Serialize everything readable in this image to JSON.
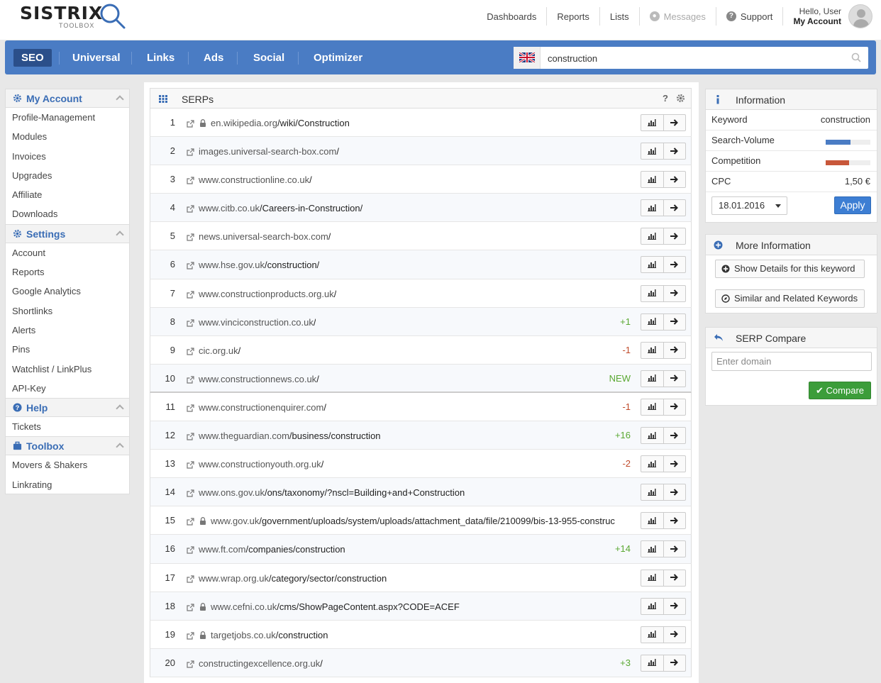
{
  "brand": {
    "name": "SISTRIX",
    "sub": "TOOLBOX"
  },
  "topnav": {
    "dashboards": "Dashboards",
    "reports": "Reports",
    "lists": "Lists",
    "messages": "Messages",
    "support": "Support",
    "hello": "Hello, User",
    "my_account": "My Account"
  },
  "modules": [
    "SEO",
    "Universal",
    "Links",
    "Ads",
    "Social",
    "Optimizer"
  ],
  "search": {
    "value": "construction",
    "flag": "uk-flag-icon"
  },
  "sidebar": {
    "my_account": {
      "title": "My Account",
      "items": [
        "Profile-Management",
        "Modules",
        "Invoices",
        "Upgrades",
        "Affiliate",
        "Downloads"
      ]
    },
    "settings": {
      "title": "Settings",
      "items": [
        "Account",
        "Reports",
        "Google Analytics",
        "Shortlinks",
        "Alerts",
        "Pins",
        "Watchlist / LinkPlus",
        "API-Key"
      ]
    },
    "help": {
      "title": "Help",
      "items": [
        "Tickets"
      ]
    },
    "toolbox": {
      "title": "Toolbox",
      "items": [
        "Movers & Shakers",
        "Linkrating"
      ]
    }
  },
  "serps": {
    "title": "SERPs",
    "help": "?",
    "rows": [
      {
        "n": "1",
        "dom": "en.wikipedia.org",
        "path": "/wiki/Construction",
        "lock": true,
        "chg": "",
        "cls": ""
      },
      {
        "n": "2",
        "dom": "images.universal-search-box.com",
        "path": "/",
        "lock": false,
        "chg": "",
        "cls": ""
      },
      {
        "n": "3",
        "dom": "www.constructionline.co.uk",
        "path": "/",
        "lock": false,
        "chg": "",
        "cls": ""
      },
      {
        "n": "4",
        "dom": "www.citb.co.uk",
        "path": "/Careers-in-Construction/",
        "lock": false,
        "chg": "",
        "cls": ""
      },
      {
        "n": "5",
        "dom": "news.universal-search-box.com",
        "path": "/",
        "lock": false,
        "chg": "",
        "cls": ""
      },
      {
        "n": "6",
        "dom": "www.hse.gov.uk",
        "path": "/construction/",
        "lock": false,
        "chg": "",
        "cls": ""
      },
      {
        "n": "7",
        "dom": "www.constructionproducts.org.uk",
        "path": "/",
        "lock": false,
        "chg": "",
        "cls": ""
      },
      {
        "n": "8",
        "dom": "www.vinciconstruction.co.uk",
        "path": "/",
        "lock": false,
        "chg": "+1",
        "cls": "pos"
      },
      {
        "n": "9",
        "dom": "cic.org.uk",
        "path": "/",
        "lock": false,
        "chg": "-1",
        "cls": "neg"
      },
      {
        "n": "10",
        "dom": "www.constructionnews.co.uk",
        "path": "/",
        "lock": false,
        "chg": "NEW",
        "cls": "pos"
      },
      {
        "n": "11",
        "dom": "www.constructionenquirer.com",
        "path": "/",
        "lock": false,
        "chg": "-1",
        "cls": "neg"
      },
      {
        "n": "12",
        "dom": "www.theguardian.com",
        "path": "/business/construction",
        "lock": false,
        "chg": "+16",
        "cls": "pos"
      },
      {
        "n": "13",
        "dom": "www.constructionyouth.org.uk",
        "path": "/",
        "lock": false,
        "chg": "-2",
        "cls": "neg"
      },
      {
        "n": "14",
        "dom": "www.ons.gov.uk",
        "path": "/ons/taxonomy/?nscl=Building+and+Construction",
        "lock": false,
        "chg": "",
        "cls": ""
      },
      {
        "n": "15",
        "dom": "www.gov.uk",
        "path": "/government/uploads/system/uploads/attachment_data/file/210099/bis-13-955-construc",
        "lock": true,
        "chg": "",
        "cls": ""
      },
      {
        "n": "16",
        "dom": "www.ft.com",
        "path": "/companies/construction",
        "lock": false,
        "chg": "+14",
        "cls": "pos"
      },
      {
        "n": "17",
        "dom": "www.wrap.org.uk",
        "path": "/category/sector/construction",
        "lock": false,
        "chg": "",
        "cls": ""
      },
      {
        "n": "18",
        "dom": "www.cefni.co.uk",
        "path": "/cms/ShowPageContent.aspx?CODE=ACEF",
        "lock": true,
        "chg": "",
        "cls": ""
      },
      {
        "n": "19",
        "dom": "targetjobs.co.uk",
        "path": "/construction",
        "lock": true,
        "chg": "",
        "cls": ""
      },
      {
        "n": "20",
        "dom": "constructingexcellence.org.uk",
        "path": "/",
        "lock": false,
        "chg": "+3",
        "cls": "pos"
      }
    ]
  },
  "info": {
    "title": "Information",
    "keyword_label": "Keyword",
    "keyword_value": "construction",
    "volume_label": "Search-Volume",
    "volume_fill": 0.55,
    "volume_color": "#4a7cc4",
    "competition_label": "Competition",
    "competition_fill": 0.52,
    "competition_color": "#c8573a",
    "cpc_label": "CPC",
    "cpc_value": "1,50 €",
    "date": "18.01.2016",
    "apply": "Apply"
  },
  "more_info": {
    "title": "More Information",
    "details": "Show Details for this keyword",
    "similar": "Similar and Related Keywords"
  },
  "serp_compare": {
    "title": "SERP Compare",
    "placeholder": "Enter domain",
    "compare": "Compare"
  }
}
